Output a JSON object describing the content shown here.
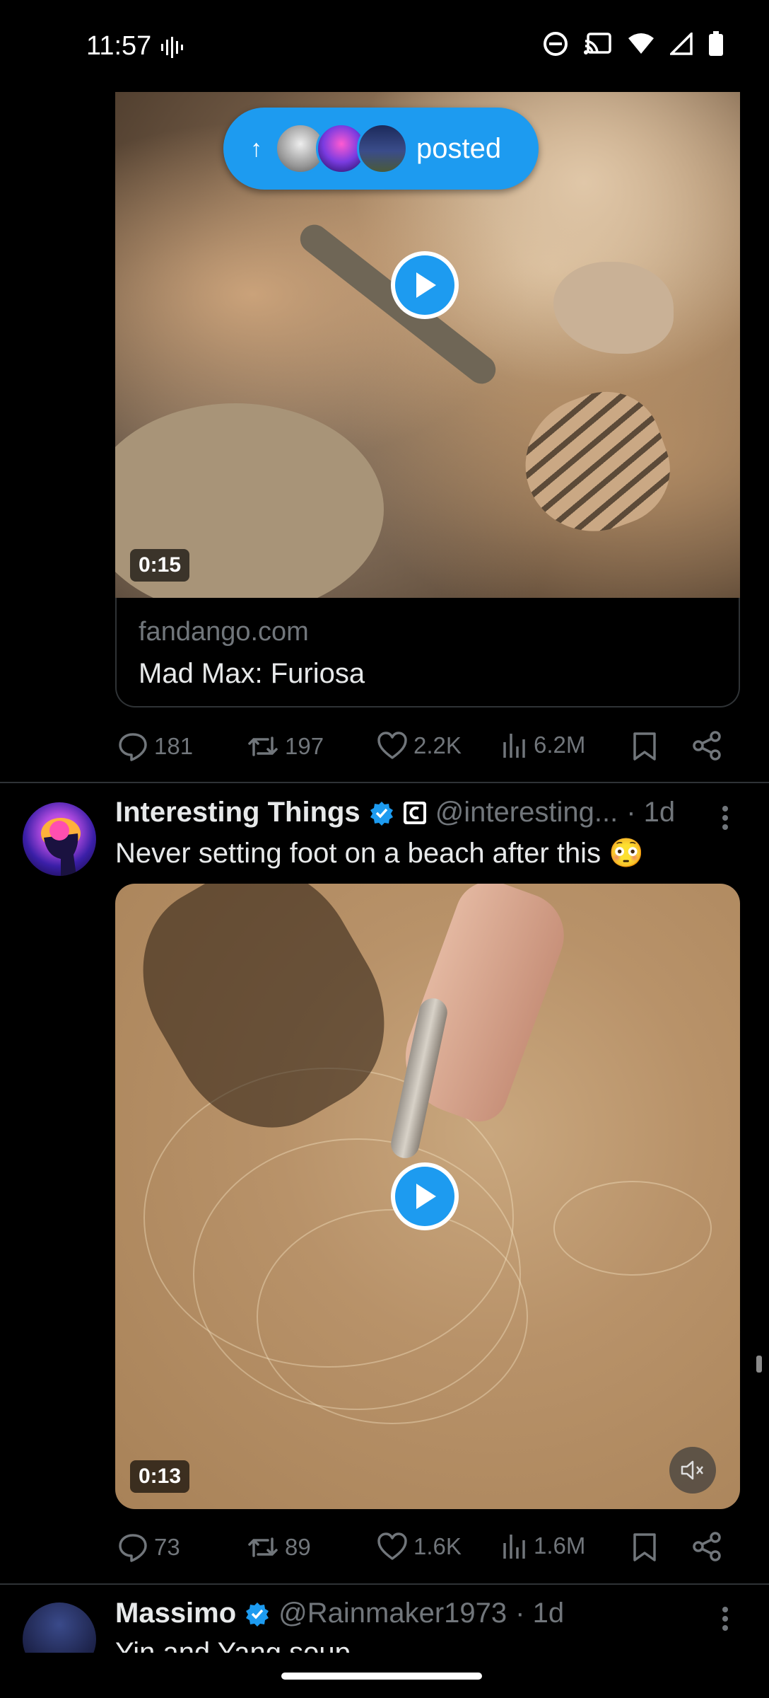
{
  "status_bar": {
    "time": "11:57",
    "icons": [
      "voice-activity-icon",
      "do-not-disturb-icon",
      "cast-icon",
      "wifi-icon",
      "cell-signal-icon",
      "battery-icon"
    ]
  },
  "new_posts_pill": {
    "label": "posted"
  },
  "tweet1": {
    "media": {
      "duration": "0:15"
    },
    "card": {
      "domain": "fandango.com",
      "title": "Mad Max: Furiosa"
    },
    "actions": {
      "replies": "181",
      "reposts": "197",
      "likes": "2.2K",
      "views": "6.2M"
    }
  },
  "tweet2": {
    "author": "Interesting Things",
    "handle": "@interesting...",
    "time": "· 1d",
    "text": "Never setting foot on a beach after this 😳",
    "media": {
      "duration": "0:13"
    },
    "actions": {
      "replies": "73",
      "reposts": "89",
      "likes": "1.6K",
      "views": "1.6M"
    }
  },
  "tweet3": {
    "author": "Massimo",
    "handle": "@Rainmaker1973",
    "time": "· 1d",
    "text": "Yin and Yang soup"
  },
  "colors": {
    "accent": "#1d9bf0",
    "background": "#000000",
    "muted": "#71767b",
    "text": "#e7e9ea"
  }
}
